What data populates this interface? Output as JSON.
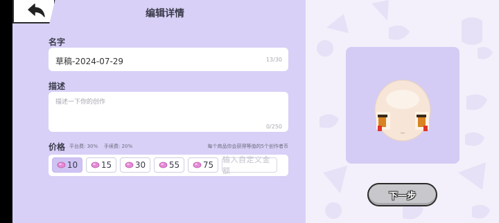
{
  "header": {
    "title": "编辑详情"
  },
  "form": {
    "name": {
      "label": "名字",
      "value": "草稿-2024-07-29",
      "counter": "13/30"
    },
    "description": {
      "label": "描述",
      "placeholder": "描述一下你的创作",
      "counter": "0/250"
    },
    "price": {
      "label": "价格",
      "platform_fee": "平台费: 30%",
      "handling_fee": "手续费: 20%",
      "note": "每个商品你会获得等值的5个创作者币",
      "options": [
        "10",
        "15",
        "30",
        "55",
        "75"
      ],
      "selected_value": "10",
      "custom_placeholder": "输入自定义金额"
    }
  },
  "preview": {
    "next_label": "下一步"
  },
  "colors": {
    "panel_bg": "#d8d0f6",
    "preview_card": "#d4ccf4",
    "chip_selected": "#cec3f3",
    "gem": "#e58ad6",
    "button_gray": "#c8c8cc"
  },
  "icons": {
    "back": "back-arrow-icon",
    "currency": "gem-icon"
  }
}
